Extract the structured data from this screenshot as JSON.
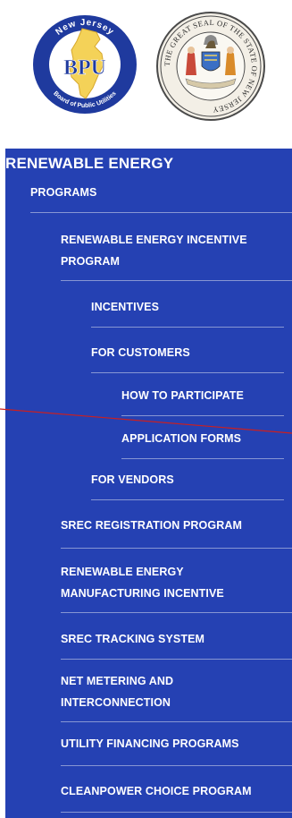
{
  "header": {
    "bpu_logo": {
      "ring_top_text": "New Jersey",
      "ring_bottom_text": "Board of Public Utilities",
      "center_text": "BPU",
      "colors": {
        "ring": "#1f3a9e",
        "state": "#f4d258",
        "text": "#1f3a9e"
      }
    },
    "state_seal": {
      "ring_text": "THE GREAT SEAL OF THE STATE OF NEW JERSEY",
      "colors": {
        "ring": "#3a3a3a",
        "fill": "#f3efe6"
      }
    }
  },
  "nav": {
    "title": "RENEWABLE ENERGY",
    "items": [
      {
        "label": "PROGRAMS"
      },
      {
        "label_lines": [
          "RENEWABLE ENERGY INCENTIVE",
          "PROGRAM"
        ]
      },
      {
        "label": "INCENTIVES"
      },
      {
        "label": "FOR CUSTOMERS"
      },
      {
        "label": "HOW TO PARTICIPATE"
      },
      {
        "label": "APPLICATION FORMS"
      },
      {
        "label": "FOR VENDORS"
      },
      {
        "label": "SREC REGISTRATION PROGRAM"
      },
      {
        "label_lines": [
          "RENEWABLE ENERGY",
          "MANUFACTURING INCENTIVE"
        ]
      },
      {
        "label": "SREC TRACKING SYSTEM"
      },
      {
        "label_lines": [
          "NET METERING AND",
          "INTERCONNECTION"
        ]
      },
      {
        "label": "UTILITY FINANCING PROGRAMS"
      },
      {
        "label": "CLEANPOWER CHOICE PROGRAM"
      }
    ]
  },
  "colors": {
    "nav_background": "#2541b3",
    "nav_text": "#ffffff",
    "divider": "#8796d3",
    "annotation_line": "#cc1f1f"
  }
}
